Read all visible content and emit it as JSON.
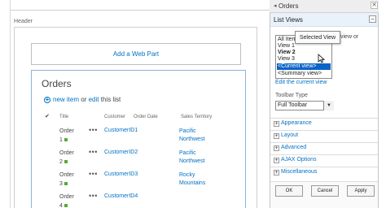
{
  "page": {
    "zone_label": "Header",
    "add_web_part": "Add a Web Part"
  },
  "webpart": {
    "title": "Orders",
    "new_item_link": "new item",
    "or_text": "or",
    "edit_link": "edit",
    "this_list_text": "this list",
    "columns": [
      "Title",
      "Customer",
      "Order Date",
      "Sales Territory"
    ],
    "rows": [
      {
        "title_line1": "Order",
        "title_line2": "1",
        "customer": "CustomerID1",
        "territory_line1": "Pacific",
        "territory_line2": "Northwest"
      },
      {
        "title_line1": "Order",
        "title_line2": "2",
        "customer": "CustomerID2",
        "territory_line1": "Pacific",
        "territory_line2": "Northwest"
      },
      {
        "title_line1": "Order",
        "title_line2": "3",
        "customer": "CustomerID3",
        "territory_line1": "Rocky",
        "territory_line2": "Mountains"
      },
      {
        "title_line1": "Order",
        "title_line2": "4",
        "customer": "CustomerID4",
        "territory_line1": "",
        "territory_line2": ""
      }
    ],
    "ellipsis": "•••"
  },
  "toolpane": {
    "title": "Orders",
    "section_title": "List Views",
    "view_options": [
      "All Items",
      "View 1",
      "View 2",
      "View 3",
      "<Current view>",
      "<Summary view>"
    ],
    "selected_view_index": 4,
    "bold_view_index": 2,
    "tooltip": "Selected View",
    "view_or_text": "view or",
    "edit_current_view": "Edit the current view",
    "toolbar_type_label": "Toolbar Type",
    "toolbar_type_value": "Full Toolbar",
    "categories": [
      "Appearance",
      "Layout",
      "Advanced",
      "AJAX Options",
      "Miscellaneous"
    ],
    "ok": "OK",
    "cancel": "Cancel",
    "apply": "Apply"
  },
  "colors": {
    "link": "#0072c6",
    "selection": "#0a64c8",
    "section_header": "#e9f1fa",
    "new_badge": "#58a83a"
  }
}
